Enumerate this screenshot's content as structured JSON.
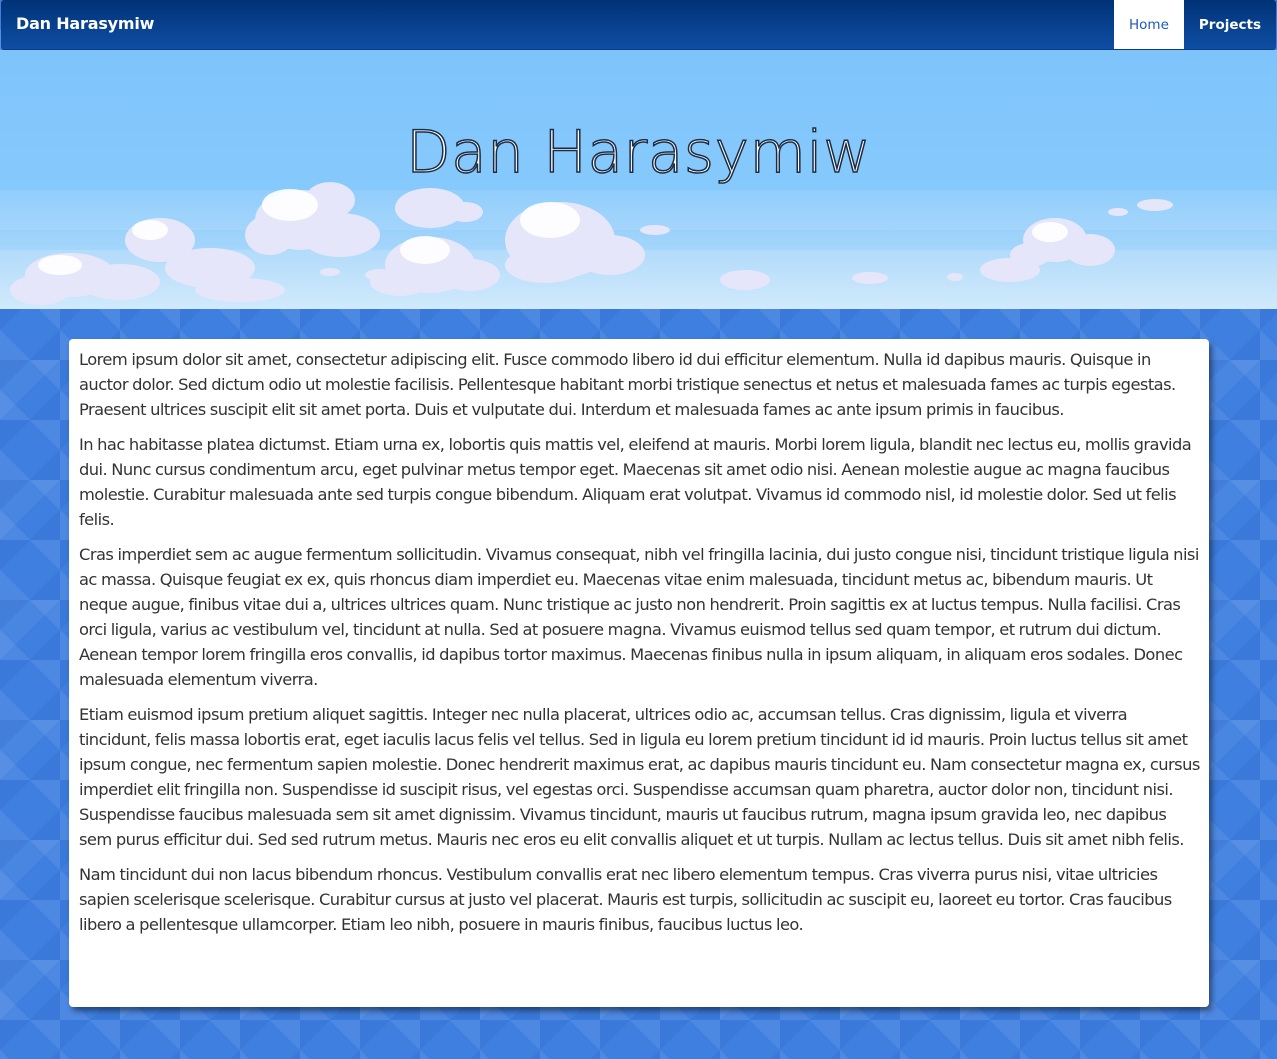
{
  "navbar": {
    "brand": "Dan Harasymiw",
    "links": [
      {
        "label": "Home",
        "active": true
      },
      {
        "label": "Projects",
        "active": false
      }
    ]
  },
  "hero": {
    "title": "Dan Harasymiw"
  },
  "content": {
    "paragraphs": [
      "Lorem ipsum dolor sit amet, consectetur adipiscing elit. Fusce commodo libero id dui efficitur elementum. Nulla id dapibus mauris. Quisque in auctor dolor. Sed dictum odio ut molestie facilisis. Pellentesque habitant morbi tristique senectus et netus et malesuada fames ac turpis egestas. Praesent ultrices suscipit elit sit amet porta. Duis et vulputate dui. Interdum et malesuada fames ac ante ipsum primis in faucibus.",
      "In hac habitasse platea dictumst. Etiam urna ex, lobortis quis mattis vel, eleifend at mauris. Morbi lorem ligula, blandit nec lectus eu, mollis gravida dui. Nunc cursus condimentum arcu, eget pulvinar metus tempor eget. Maecenas sit amet odio nisi. Aenean molestie augue ac magna faucibus molestie. Curabitur malesuada ante sed turpis congue bibendum. Aliquam erat volutpat. Vivamus id commodo nisl, id molestie dolor. Sed ut felis felis.",
      "Cras imperdiet sem ac augue fermentum sollicitudin. Vivamus consequat, nibh vel fringilla lacinia, dui justo congue nisi, tincidunt tristique ligula nisi ac massa. Quisque feugiat ex ex, quis rhoncus diam imperdiet eu. Maecenas vitae enim malesuada, tincidunt metus ac, bibendum mauris. Ut neque augue, finibus vitae dui a, ultrices ultrices quam. Nunc tristique ac justo non hendrerit. Proin sagittis ex at luctus tempus. Nulla facilisi. Cras orci ligula, varius ac vestibulum vel, tincidunt at nulla. Sed at posuere magna. Vivamus euismod tellus sed quam tempor, et rutrum dui dictum. Aenean tempor lorem fringilla eros convallis, id dapibus tortor maximus. Maecenas finibus nulla in ipsum aliquam, in aliquam eros sodales. Donec malesuada elementum viverra.",
      "Etiam euismod ipsum pretium aliquet sagittis. Integer nec nulla placerat, ultrices odio ac, accumsan tellus. Cras dignissim, ligula et viverra tincidunt, felis massa lobortis erat, eget iaculis lacus felis vel tellus. Sed in ligula eu lorem pretium tincidunt id id mauris. Proin luctus tellus sit amet ipsum congue, nec fermentum sapien molestie. Donec hendrerit maximus erat, ac dapibus mauris tincidunt eu. Nam consectetur magna ex, cursus imperdiet elit fringilla non. Suspendisse id suscipit risus, vel egestas orci. Suspendisse accumsan quam pharetra, auctor dolor non, tincidunt nisi. Suspendisse faucibus malesuada sem sit amet dignissim. Vivamus tincidunt, mauris ut faucibus rutrum, magna ipsum gravida leo, nec dapibus sem purus efficitur dui. Sed sed rutrum metus. Mauris nec eros eu elit convallis aliquet et ut turpis. Nullam ac lectus tellus. Duis sit amet nibh felis.",
      "Nam tincidunt dui non lacus bibendum rhoncus. Vestibulum convallis erat nec libero elementum tempus. Cras viverra purus nisi, vitae ultricies sapien scelerisque scelerisque. Curabitur cursus at justo vel placerat. Mauris est turpis, sollicitudin ac suscipit eu, laoreet eu tortor. Cras faucibus libero a pellentesque ullamcorper. Etiam leo nibh, posuere in mauris finibus, faucibus luctus leo."
    ]
  },
  "colors": {
    "navbar": "#0a3f8c",
    "sky": "#86c9fc",
    "page_background": "#3f7fe0",
    "text": "#333333",
    "active_link": "#1a5bb8"
  }
}
